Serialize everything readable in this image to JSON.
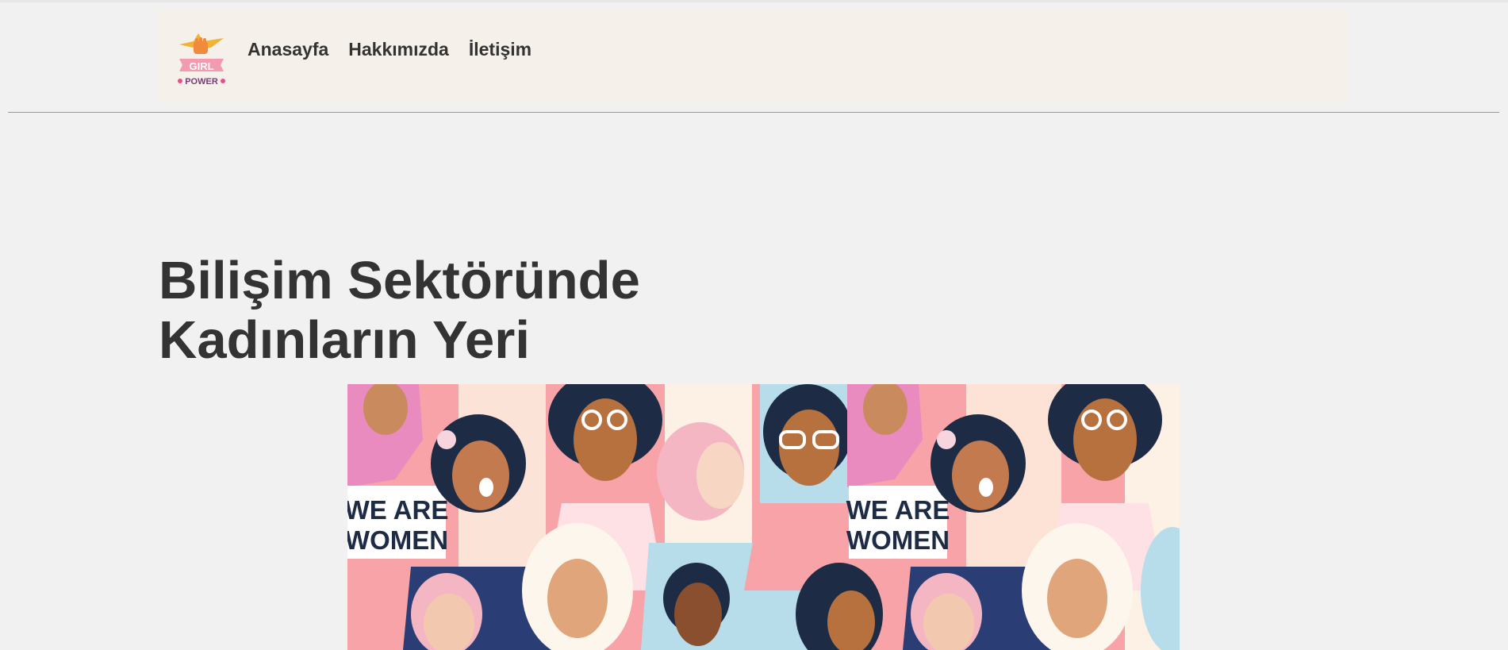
{
  "nav": {
    "logo_text_line1": "GIRL",
    "logo_text_line2": "POWER",
    "links": [
      {
        "label": "Anasayfa"
      },
      {
        "label": "Hakkımızda"
      },
      {
        "label": "İletişim"
      }
    ]
  },
  "hero": {
    "title_line1": "Bilişim Sektöründe",
    "title_line2": "Kadınların Yeri",
    "image_sign_line1": "WE ARE",
    "image_sign_line2": "WOMEN"
  },
  "colors": {
    "page_background": "#f1f1f1",
    "navbar_background": "#f5f0ea",
    "text": "#333333",
    "divider": "#9a9a9a"
  }
}
